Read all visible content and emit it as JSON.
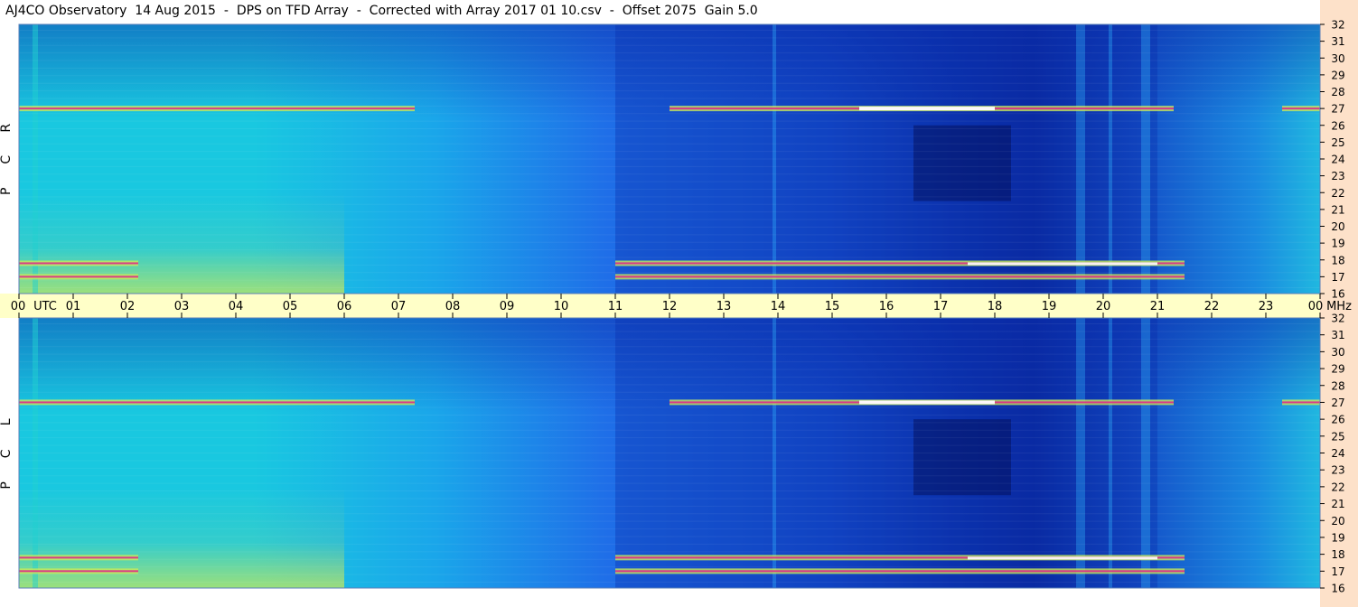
{
  "title": "AJ4CO Observatory  14 Aug 2015  -  DPS on TFD Array  -  Corrected with Array 2017 01 10.csv  -  Offset 2075  Gain 5.0",
  "colors": {
    "background_strip": "#fde1c9",
    "axis_band": "#ffffc8",
    "deep_blue": "#0a2aa8",
    "mid_blue": "#1f6fe8",
    "cyan": "#19c8e0",
    "green_yellow": "#c8e85a",
    "magenta": "#e0208c",
    "white": "#ffffff"
  },
  "chart_data": [
    {
      "type": "heatmap",
      "panel_label": "R C P",
      "x_unit_label": "UTC",
      "y_unit_label": "MHz",
      "x_ticks": [
        "00",
        "01",
        "02",
        "03",
        "04",
        "05",
        "06",
        "07",
        "08",
        "09",
        "10",
        "11",
        "12",
        "13",
        "14",
        "15",
        "16",
        "17",
        "18",
        "19",
        "20",
        "21",
        "22",
        "23",
        "00"
      ],
      "xlim": [
        0,
        24
      ],
      "y_ticks": [
        16,
        17,
        18,
        19,
        20,
        21,
        22,
        23,
        24,
        25,
        26,
        27,
        28,
        29,
        30,
        31,
        32
      ],
      "ylim": [
        16,
        32
      ],
      "bright_bands_mhz": [
        27.0,
        17.8,
        17.0
      ],
      "dark_region_utc": [
        11,
        21
      ]
    },
    {
      "type": "heatmap",
      "panel_label": "L C P",
      "x_unit_label": "UTC",
      "y_unit_label": "MHz",
      "x_ticks": [
        "00",
        "01",
        "02",
        "03",
        "04",
        "05",
        "06",
        "07",
        "08",
        "09",
        "10",
        "11",
        "12",
        "13",
        "14",
        "15",
        "16",
        "17",
        "18",
        "19",
        "20",
        "21",
        "22",
        "23",
        "00"
      ],
      "xlim": [
        0,
        24
      ],
      "y_ticks": [
        16,
        17,
        18,
        19,
        20,
        21,
        22,
        23,
        24,
        25,
        26,
        27,
        28,
        29,
        30,
        31,
        32
      ],
      "ylim": [
        16,
        32
      ],
      "bright_bands_mhz": [
        27.0,
        17.8,
        17.0
      ],
      "dark_region_utc": [
        11,
        21
      ]
    }
  ]
}
